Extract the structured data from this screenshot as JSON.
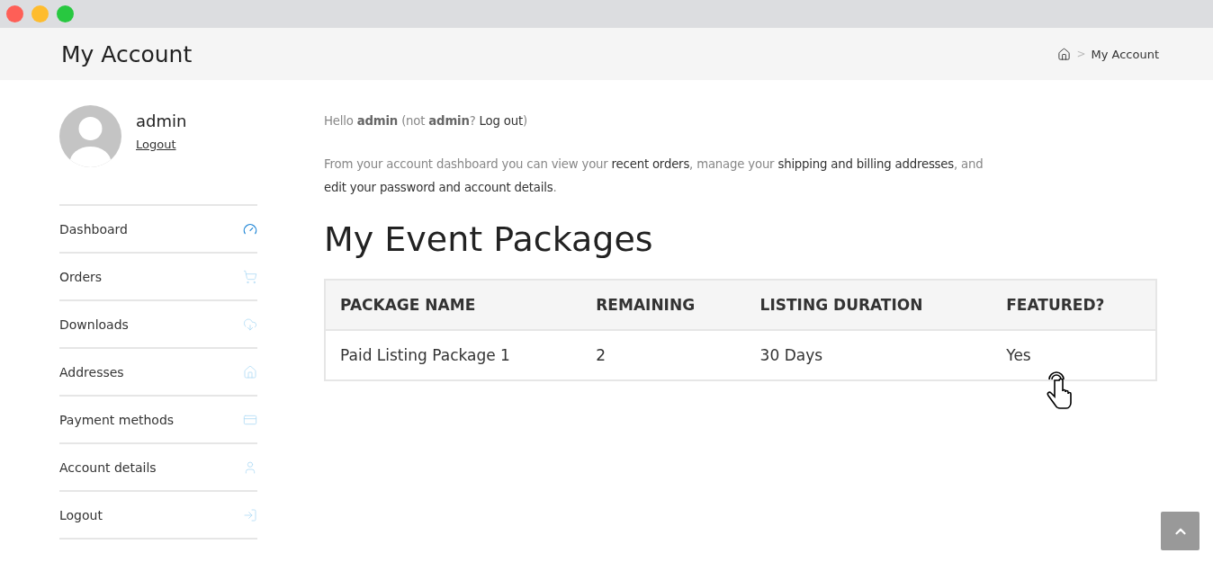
{
  "header": {
    "title": "My Account",
    "breadcrumb": {
      "separator": ">",
      "current": "My Account"
    }
  },
  "profile": {
    "name": "admin",
    "logout": "Logout"
  },
  "menu": [
    {
      "label": "Dashboard",
      "selected": true
    },
    {
      "label": "Orders",
      "selected": false
    },
    {
      "label": "Downloads",
      "selected": false
    },
    {
      "label": "Addresses",
      "selected": false
    },
    {
      "label": "Payment methods",
      "selected": false
    },
    {
      "label": "Account details",
      "selected": false
    },
    {
      "label": "Logout",
      "selected": false
    }
  ],
  "greeting": [
    {
      "kind": "text",
      "text": "Hello **admin** (not **admin**? "
    },
    {
      "kind": "link",
      "text": "Log out"
    },
    {
      "kind": "text",
      "text": ")"
    }
  ],
  "intro": [
    {
      "kind": "text",
      "text": "From your account dashboard you can view your "
    },
    {
      "kind": "link",
      "text": "recent orders"
    },
    {
      "kind": "text",
      "text": ", manage your "
    },
    {
      "kind": "link",
      "text": "shipping and billing addresses"
    },
    {
      "kind": "text",
      "text": ", and "
    },
    {
      "kind": "link",
      "text": "edit your password and account details"
    },
    {
      "kind": "text",
      "text": "."
    }
  ],
  "packages": {
    "title": "My Event Packages",
    "columns": [
      "PACKAGE NAME",
      "REMAINING",
      "LISTING DURATION",
      "FEATURED?"
    ],
    "rows": [
      [
        "Paid Listing Package 1",
        "2",
        "30 Days",
        "Yes"
      ]
    ]
  }
}
